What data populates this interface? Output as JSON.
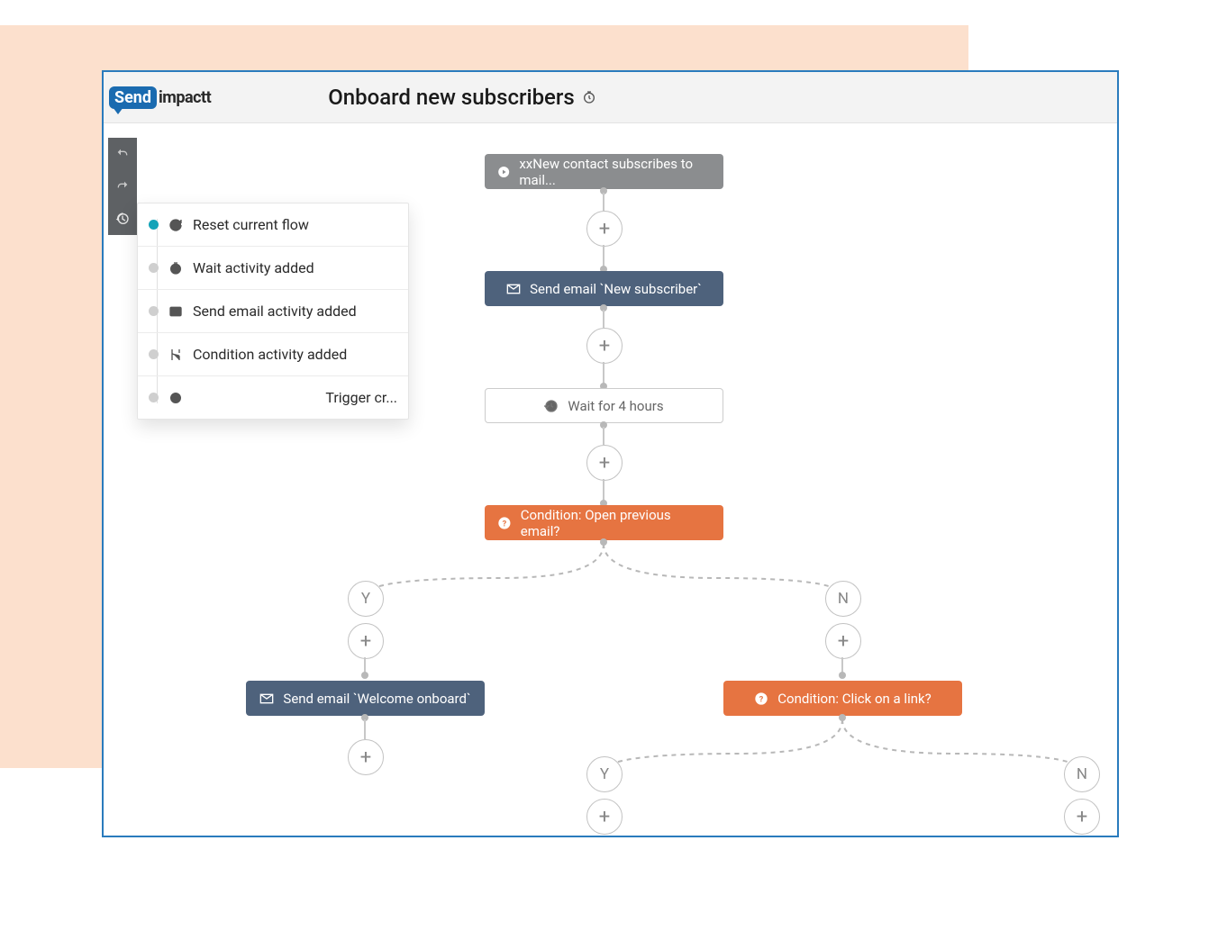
{
  "logo": {
    "send": "Send",
    "impactt": "impactt"
  },
  "title": "Onboard new subscribers",
  "history": {
    "items": [
      {
        "label": "Reset current flow",
        "active": true,
        "icon": "reset"
      },
      {
        "label": "Wait activity added",
        "active": false,
        "icon": "clock"
      },
      {
        "label": "Send email activity added",
        "active": false,
        "icon": "mail"
      },
      {
        "label": "Condition activity added",
        "active": false,
        "icon": "branch"
      },
      {
        "label": "Trigger cr...",
        "active": false,
        "icon": "target"
      }
    ]
  },
  "flow": {
    "trigger": {
      "label": "xxNew contact subscribes to mail..."
    },
    "email1": {
      "label": "Send email `New subscriber`"
    },
    "wait": {
      "label": "Wait for 4 hours"
    },
    "cond1": {
      "label": "Condition: Open previous email?"
    },
    "branch": {
      "yes": "Y",
      "no": "N"
    },
    "email2": {
      "label": "Send email `Welcome onboard`"
    },
    "cond2": {
      "label": "Condition: Click on a link?"
    }
  }
}
